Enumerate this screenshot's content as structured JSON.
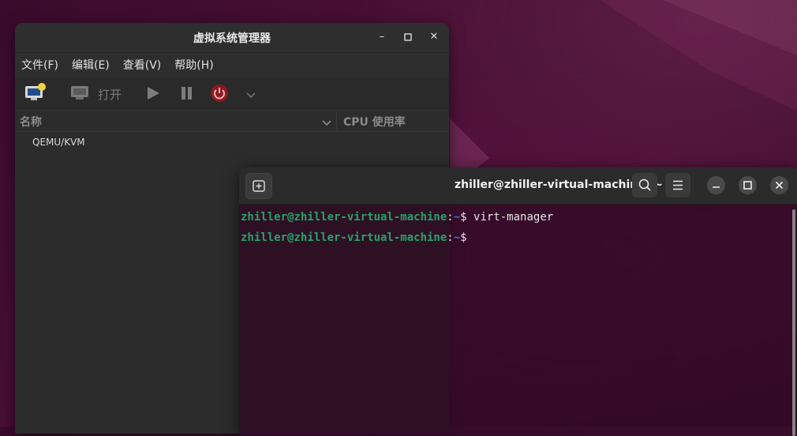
{
  "virt_manager": {
    "title": "虚拟系统管理器",
    "menus": [
      "文件(F)",
      "编辑(E)",
      "查看(V)",
      "帮助(H)"
    ],
    "toolbar": {
      "open_label": "打开"
    },
    "columns": {
      "name": "名称",
      "cpu": "CPU 使用率"
    },
    "connections": [
      "QEMU/KVM"
    ]
  },
  "terminal": {
    "title": "zhiller@zhiller-virtual-machine: ~",
    "lines": [
      {
        "user": "zhiller@zhiller-virtual-machine",
        "colon": ":",
        "path": "~",
        "dollar": "$ ",
        "command": "virt-manager"
      },
      {
        "user": "zhiller@zhiller-virtual-machine",
        "colon": ":",
        "path": "~",
        "dollar": "$",
        "command": ""
      }
    ]
  },
  "colors": {
    "desktop_bg": "#3a0b2c",
    "prompt_user": "#26a269",
    "prompt_path": "#2a7bde",
    "power_red": "#c01c28"
  }
}
